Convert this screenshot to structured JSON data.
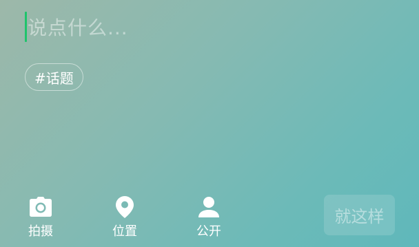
{
  "compose": {
    "placeholder": "说点什么...",
    "topic_chip_label": "#话题"
  },
  "toolbar": {
    "items": [
      {
        "label": "拍摄",
        "icon": "camera-icon"
      },
      {
        "label": "位置",
        "icon": "location-pin-icon"
      },
      {
        "label": "公开",
        "icon": "person-icon"
      }
    ],
    "submit_label": "就这样"
  },
  "colors": {
    "caret": "#1ec46b",
    "background_start": "#9db8a9",
    "background_end": "#5fb8bb"
  }
}
